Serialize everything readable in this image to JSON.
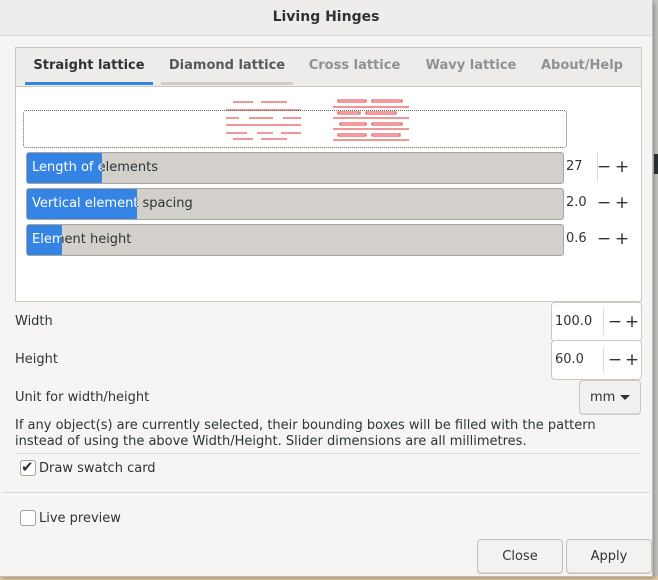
{
  "window": {
    "title": "Living Hinges"
  },
  "tabs": [
    {
      "label": "Straight lattice",
      "state": "active"
    },
    {
      "label": "Diamond lattice",
      "state": "normal"
    },
    {
      "label": "Cross lattice",
      "state": "disabled"
    },
    {
      "label": "Wavy lattice",
      "state": "disabled"
    },
    {
      "label": "About/Help",
      "state": "disabled"
    }
  ],
  "preview": {
    "stroke_color": "#e8585a"
  },
  "sliders": [
    {
      "label": "Length of elements",
      "value": "27",
      "fill_fraction": 0.14
    },
    {
      "label": "Vertical element spacing",
      "value": "2.0",
      "fill_fraction": 0.205
    },
    {
      "label": "Element height",
      "value": "0.6",
      "fill_fraction": 0.065
    }
  ],
  "fields": {
    "width": {
      "label": "Width",
      "value": "100.0"
    },
    "height": {
      "label": "Height",
      "value": "60.0"
    },
    "unit": {
      "label": "Unit for width/height",
      "value": "mm"
    }
  },
  "info_text": "If any object(s) are currently selected, their bounding boxes will be filled with the pattern instead of using the above Width/Height. Slider dimensions are all millimetres.",
  "checkboxes": {
    "swatch": {
      "label": "Draw swatch card",
      "checked": true
    },
    "live": {
      "label": "Live preview",
      "checked": false
    }
  },
  "buttons": {
    "close": "Close",
    "apply": "Apply"
  },
  "spin": {
    "minus": "−",
    "plus": "+"
  },
  "colors": {
    "accent": "#3584e4",
    "trough": "#d3d0cc"
  }
}
